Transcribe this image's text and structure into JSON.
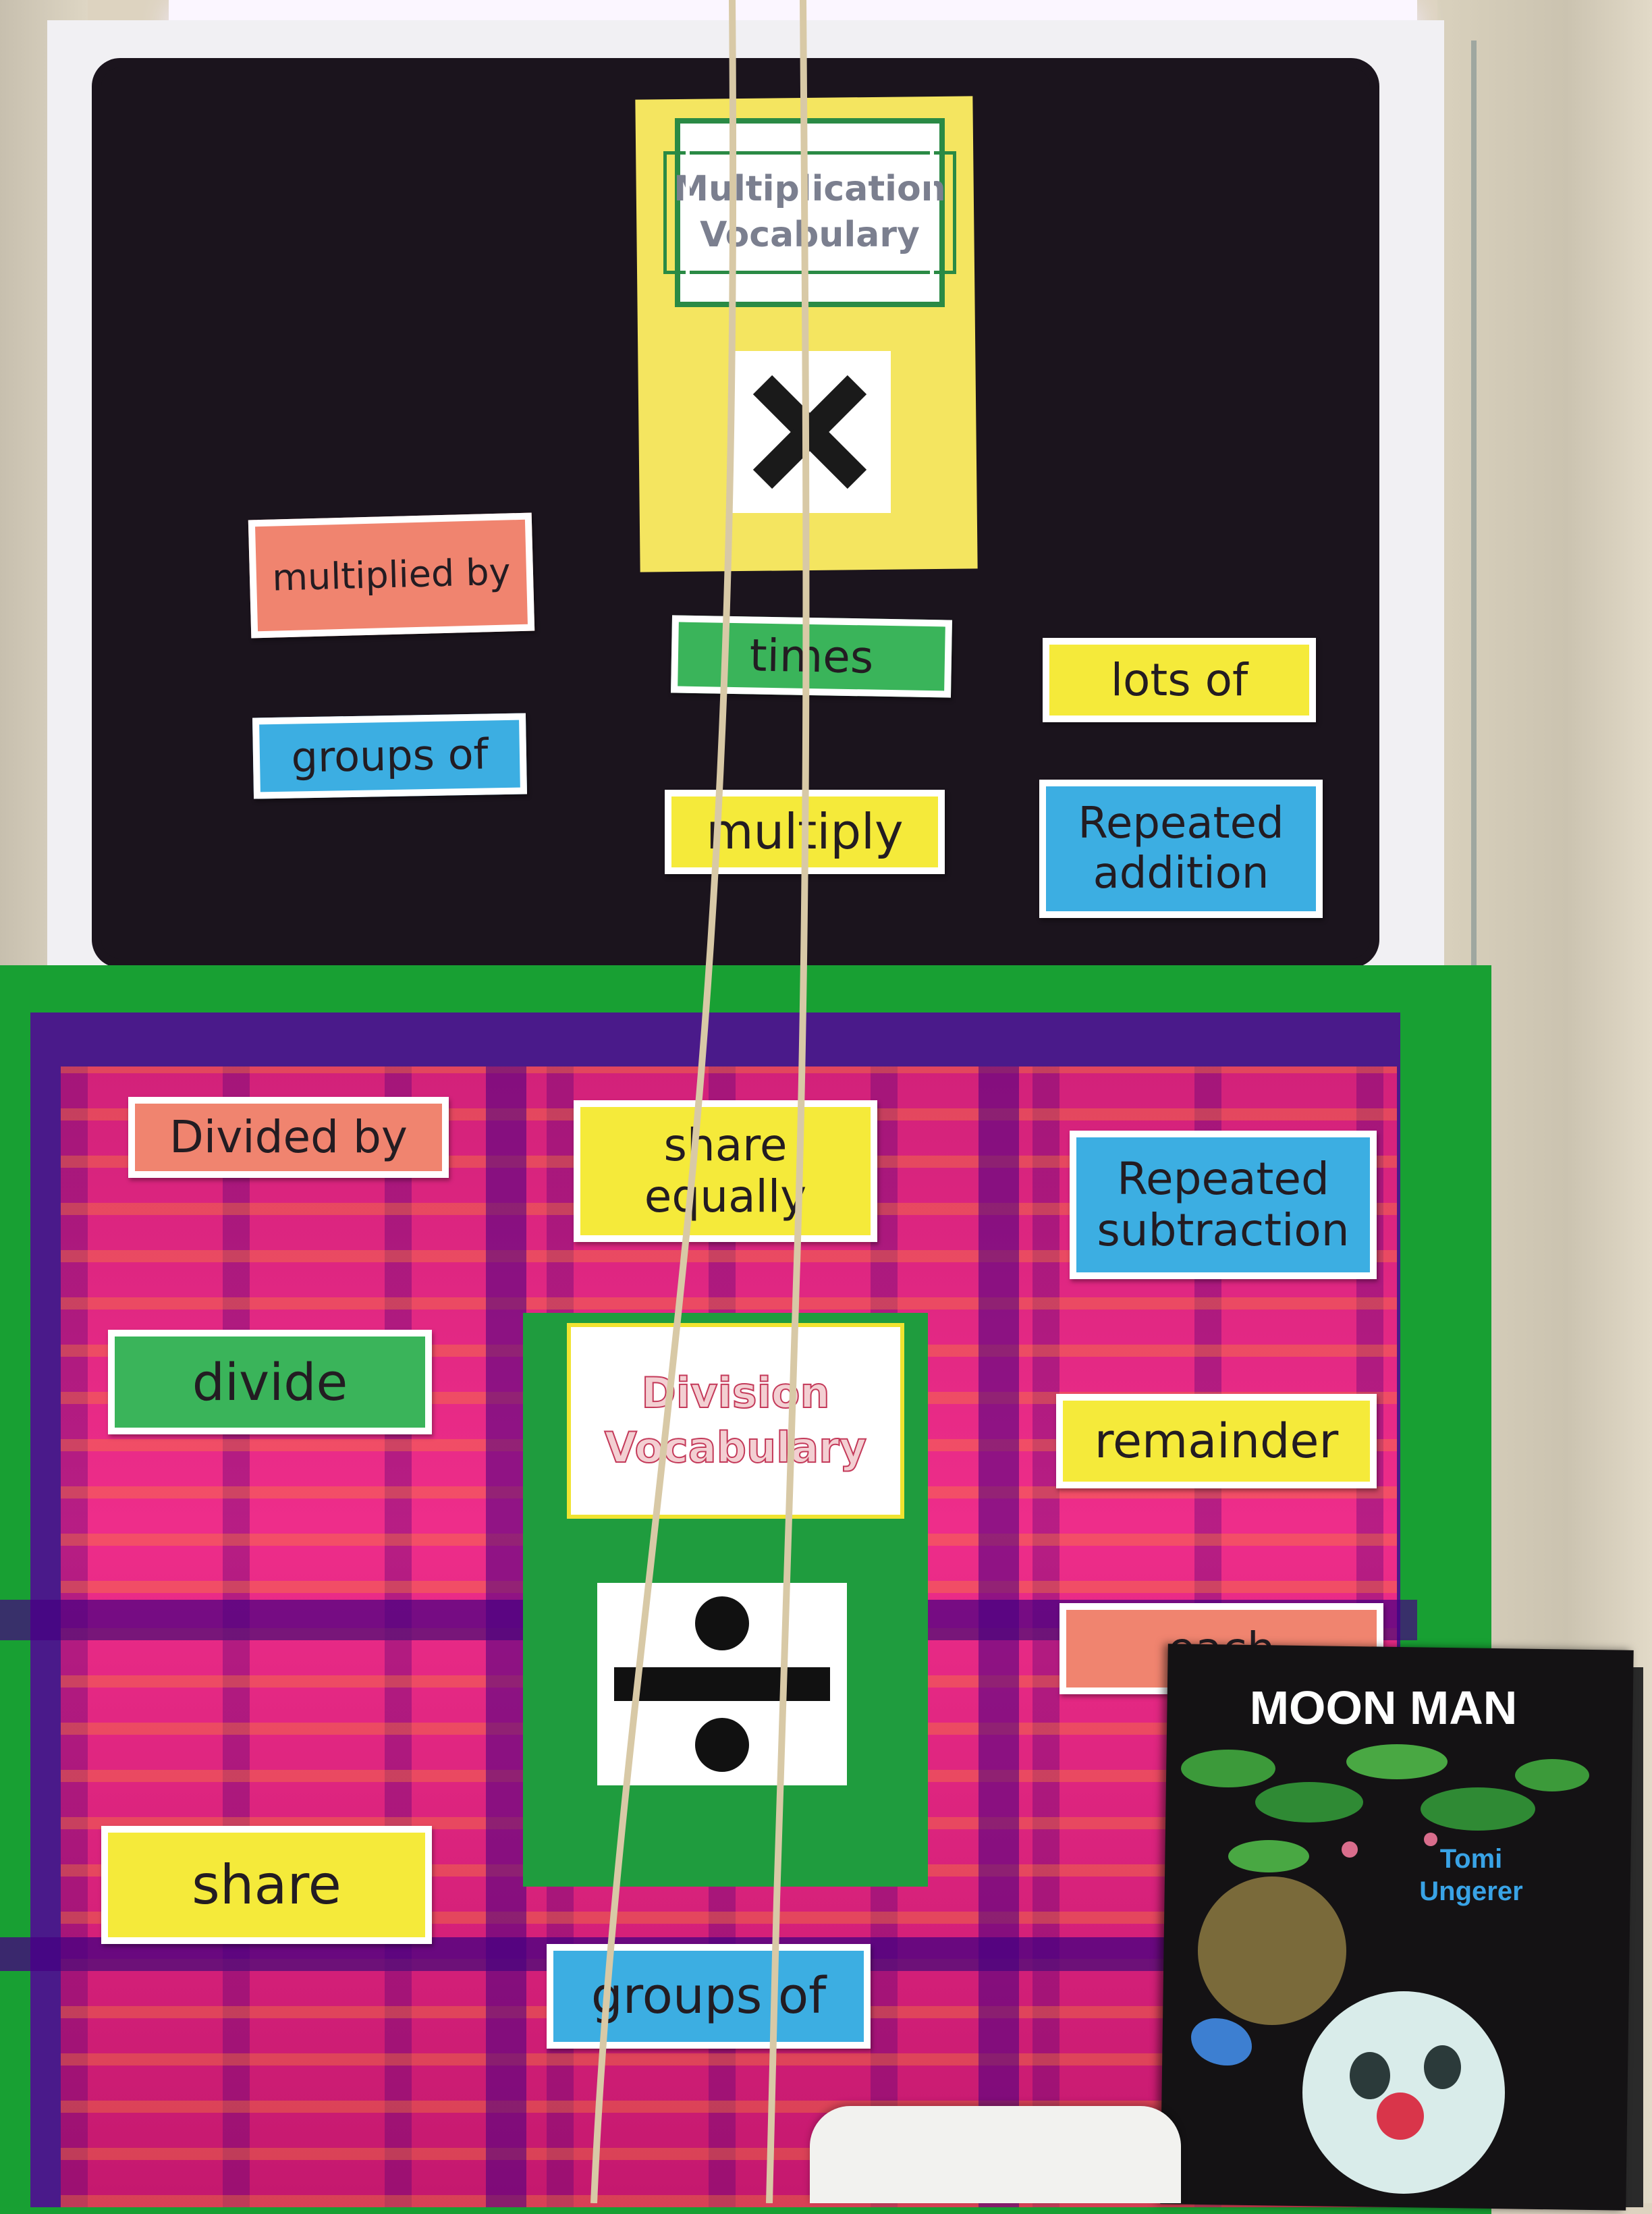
{
  "multiplication": {
    "title_line1": "Multiplication",
    "title_line2": "Vocabulary",
    "symbol": "×",
    "cards": {
      "multiplied_by": "multiplied by",
      "times": "times",
      "lots_of": "lots of",
      "groups_of": "groups of",
      "multiply": "multiply",
      "repeated_addition": "Repeated addition"
    }
  },
  "division": {
    "title_line1": "Division",
    "title_line2": "Vocabulary",
    "symbol": "÷",
    "cards": {
      "divided_by": "Divided by",
      "share_equally": "share equally",
      "repeated_subtraction": "Repeated subtraction",
      "divide": "divide",
      "remainder": "remainder",
      "each": "each",
      "share": "share",
      "groups_of": "groups of"
    }
  },
  "book": {
    "title": "MOON MAN",
    "author_line1": "Tomi",
    "author_line2": "Ungerer"
  },
  "colors": {
    "board_black": "#1b141d",
    "border_green": "#18a033",
    "fabric_pink": "#ee2d8a",
    "card_pink": "#f0846f",
    "card_green": "#3ab45a",
    "card_yellow": "#f5ea3a",
    "card_blue": "#3caee2"
  }
}
